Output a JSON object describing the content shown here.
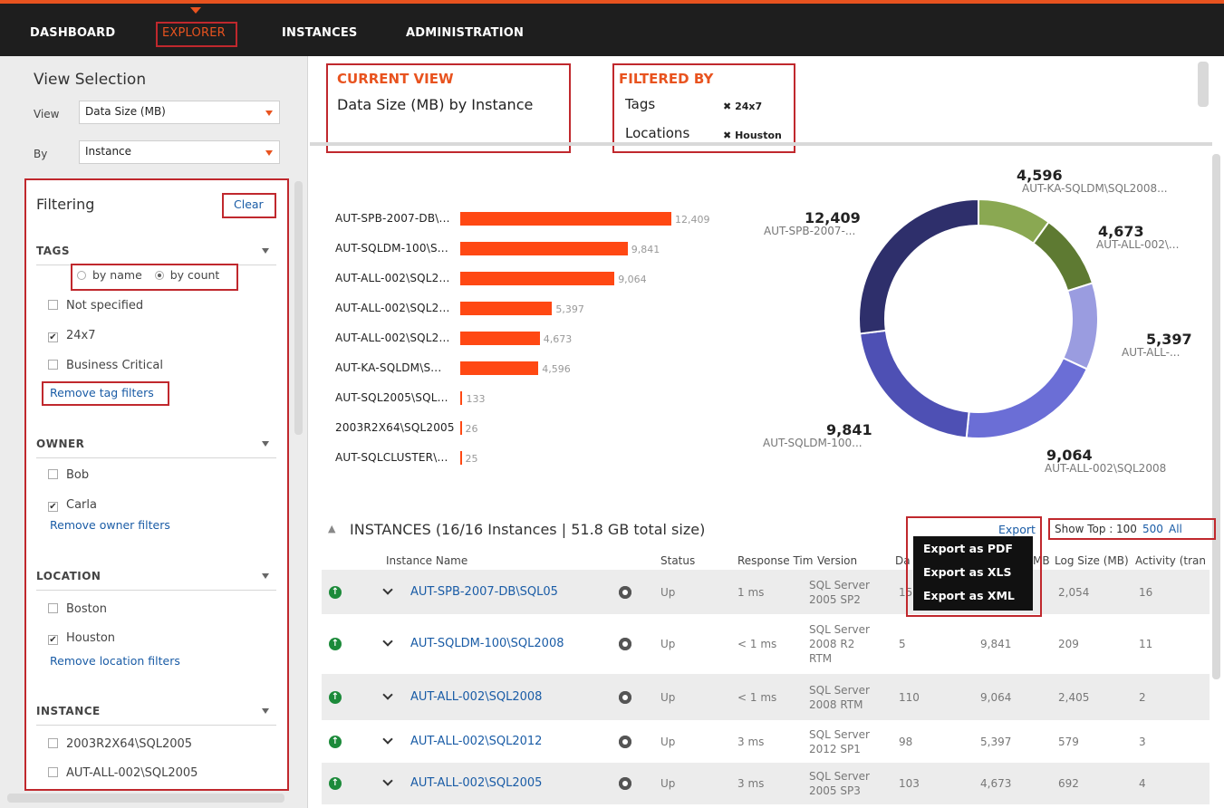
{
  "nav": {
    "items": [
      "DASHBOARD",
      "EXPLORER",
      "INSTANCES",
      "ADMINISTRATION"
    ],
    "active": "EXPLORER"
  },
  "view_selection": {
    "title": "View Selection",
    "view_label": "View",
    "view_value": "Data Size (MB)",
    "by_label": "By",
    "by_value": "Instance"
  },
  "filtering": {
    "title": "Filtering",
    "clear": "Clear",
    "tags": {
      "heading": "TAGS",
      "by_name": "by name",
      "by_count": "by count",
      "items": [
        {
          "label": "Not specified",
          "checked": false
        },
        {
          "label": "24x7",
          "checked": true
        },
        {
          "label": "Business Critical",
          "checked": false
        }
      ],
      "remove": "Remove tag filters"
    },
    "owner": {
      "heading": "OWNER",
      "items": [
        {
          "label": "Bob",
          "checked": false
        },
        {
          "label": "Carla",
          "checked": true
        }
      ],
      "remove": "Remove owner filters"
    },
    "location": {
      "heading": "LOCATION",
      "items": [
        {
          "label": "Boston",
          "checked": false
        },
        {
          "label": "Houston",
          "checked": true
        }
      ],
      "remove": "Remove location filters"
    },
    "instance": {
      "heading": "INSTANCE",
      "items": [
        {
          "label": "2003R2X64\\SQL2005",
          "checked": false
        },
        {
          "label": "AUT-ALL-002\\SQL2005",
          "checked": false
        }
      ]
    }
  },
  "current_view": {
    "heading": "CURRENT VIEW",
    "text": "Data Size (MB) by Instance"
  },
  "filtered_by": {
    "heading": "FILTERED BY",
    "tags_label": "Tags",
    "tags_value": "24x7",
    "locations_label": "Locations",
    "locations_value": "Houston"
  },
  "chart_data": [
    {
      "type": "bar",
      "categories": [
        "AUT-SPB-2007-DB\\...",
        "AUT-SQLDM-100\\S...",
        "AUT-ALL-002\\SQL2...",
        "AUT-ALL-002\\SQL2...",
        "AUT-ALL-002\\SQL2...",
        "AUT-KA-SQLDM\\S...",
        "AUT-SQL2005\\SQL...",
        "2003R2X64\\SQL2005",
        "AUT-SQLCLUSTER\\..."
      ],
      "values": [
        12409,
        9841,
        9064,
        5397,
        4673,
        4596,
        133,
        26,
        25
      ],
      "value_labels": [
        "12,409",
        "9,841",
        "9,064",
        "5,397",
        "4,673",
        "4,596",
        "133",
        "26",
        "25"
      ]
    },
    {
      "type": "pie",
      "labels": [
        "AUT-KA-SQLDM\\SQL2008...",
        "AUT-ALL-002\\...",
        "AUT-ALL-...",
        "AUT-ALL-002\\SQL2008",
        "AUT-SQLDM-100...",
        "AUT-SPB-2007-..."
      ],
      "values": [
        4596,
        4673,
        5397,
        9064,
        9841,
        12409
      ],
      "value_labels": [
        "4,596",
        "4,673",
        "5,397",
        "9,064",
        "9,841",
        "12,409"
      ],
      "colors": [
        "#8aa852",
        "#5e7a32",
        "#9a9ce0",
        "#6b6ed6",
        "#4e50b4",
        "#2e2f6b"
      ]
    }
  ],
  "instances": {
    "title": "INSTANCES (16/16 Instances | 51.8 GB total size)",
    "export": "Export",
    "export_menu": [
      "Export as PDF",
      "Export as XLS",
      "Export as XML"
    ],
    "show_top_label": "Show Top :",
    "show_top_options": [
      "100",
      "500",
      "All"
    ],
    "columns": [
      "Instance Name",
      "Status",
      "Response Tim",
      "Version",
      "Da",
      "MB",
      "Log Size (MB)",
      "Activity (tran"
    ],
    "rows": [
      {
        "name": "AUT-SPB-2007-DB\\SQL05",
        "status": "Up",
        "response": "1 ms",
        "version": "SQL Server\n2005 SP2",
        "db": "15",
        "data": "",
        "log": "2,054",
        "activity": "16"
      },
      {
        "name": "AUT-SQLDM-100\\SQL2008",
        "status": "Up",
        "response": "< 1 ms",
        "version": "SQL Server\n2008 R2\nRTM",
        "db": "5",
        "data": "9,841",
        "log": "209",
        "activity": "11"
      },
      {
        "name": "AUT-ALL-002\\SQL2008",
        "status": "Up",
        "response": "< 1 ms",
        "version": "SQL Server\n2008 RTM",
        "db": "110",
        "data": "9,064",
        "log": "2,405",
        "activity": "2"
      },
      {
        "name": "AUT-ALL-002\\SQL2012",
        "status": "Up",
        "response": "3 ms",
        "version": "SQL Server\n2012 SP1",
        "db": "98",
        "data": "5,397",
        "log": "579",
        "activity": "3"
      },
      {
        "name": "AUT-ALL-002\\SQL2005",
        "status": "Up",
        "response": "3 ms",
        "version": "SQL Server\n2005 SP3",
        "db": "103",
        "data": "4,673",
        "log": "692",
        "activity": "4"
      }
    ]
  }
}
